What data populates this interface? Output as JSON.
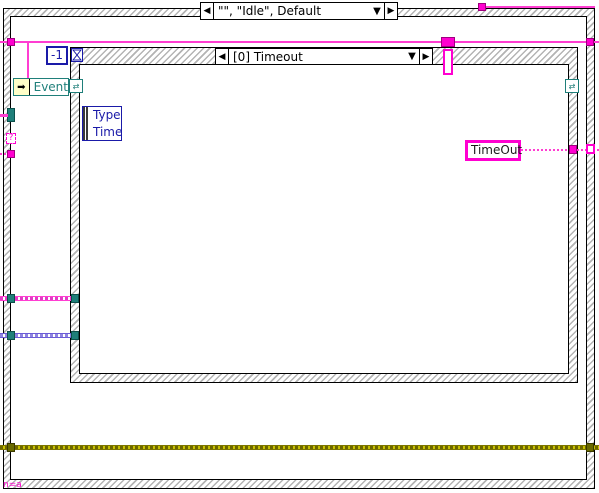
{
  "case_structure": {
    "selector_label": "\"\", \"Idle\", Default",
    "left_arrow": "◀",
    "right_arrow": "▶",
    "dropdown": "▼"
  },
  "event_structure": {
    "selector_label": "[0] Timeout",
    "left_arrow": "◀",
    "right_arrow": "▶",
    "dropdown": "▼",
    "timeout_value": "-1",
    "timeout_icon": "hourglass-icon",
    "event_data_node": {
      "rows": [
        "Type",
        "Time"
      ]
    },
    "event_constant_label": "Event",
    "string_constant": "TimeOut"
  },
  "loop": {
    "iteration_terminal": "n=a",
    "unknown_terminal": "?"
  },
  "colors": {
    "string_wire": "#ff3ed2",
    "refnum_wire": "#1f7f7a",
    "class_wire": "#6b5cd6",
    "error_wire": "#7c7500",
    "numeric_const": "#1a1aa8"
  }
}
